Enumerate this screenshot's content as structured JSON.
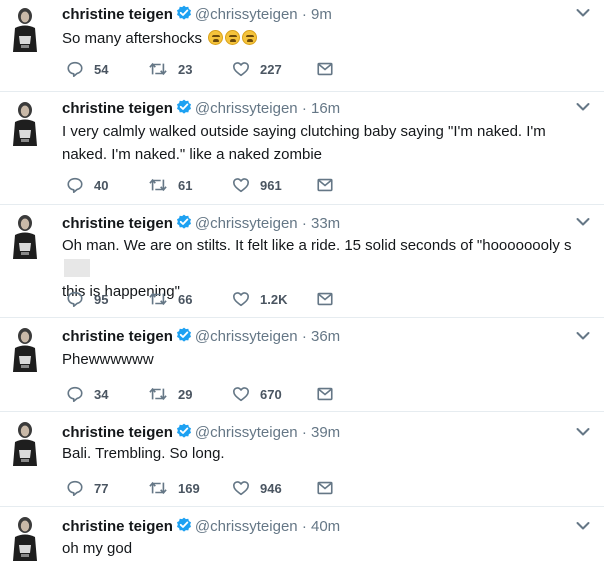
{
  "tweets": [
    {
      "name": "christine teigen",
      "handle": "@chrissyteigen",
      "sep": "·",
      "time": "9m",
      "text": "So many aftershocks",
      "emoji_count": 3,
      "replies": "54",
      "retweets": "23",
      "likes": "227"
    },
    {
      "name": "christine teigen",
      "handle": "@chrissyteigen",
      "sep": "·",
      "time": "16m",
      "text": "I very calmly walked outside saying clutching baby saying \"I'm naked. I'm naked. I'm naked.\" like a naked zombie",
      "replies": "40",
      "retweets": "61",
      "likes": "961"
    },
    {
      "name": "christine teigen",
      "handle": "@chrissyteigen",
      "sep": "·",
      "time": "33m",
      "text_a": "Oh man. We are on stilts. It felt like a ride. 15 solid seconds of \"hoooooooly s",
      "text_b": "this is happening\"",
      "replies": "95",
      "retweets": "66",
      "likes": "1.2K"
    },
    {
      "name": "christine teigen",
      "handle": "@chrissyteigen",
      "sep": "·",
      "time": "36m",
      "text": "Phewwwwww",
      "replies": "34",
      "retweets": "29",
      "likes": "670"
    },
    {
      "name": "christine teigen",
      "handle": "@chrissyteigen",
      "sep": "·",
      "time": "39m",
      "text": "Bali. Trembling. So long.",
      "replies": "77",
      "retweets": "169",
      "likes": "946"
    },
    {
      "name": "christine teigen",
      "handle": "@chrissyteigen",
      "sep": "·",
      "time": "40m",
      "text": "oh my god"
    }
  ],
  "colors": {
    "text": "#14171a",
    "muted": "#657786",
    "verified": "#1da1f2",
    "divider": "#e6ecf0"
  }
}
